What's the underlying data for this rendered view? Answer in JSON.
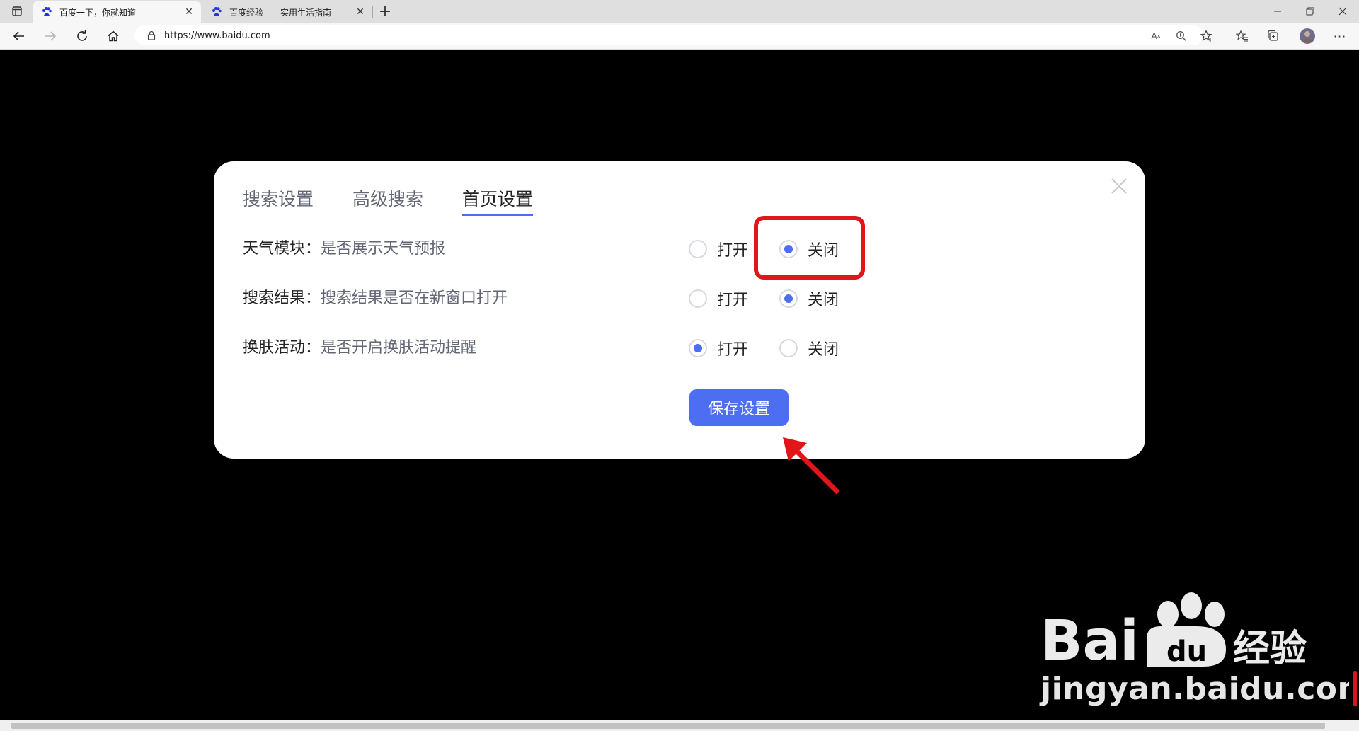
{
  "browser": {
    "tabs": [
      {
        "title": "百度一下，你就知道",
        "active": true,
        "favicon": "baidu-paw-icon"
      },
      {
        "title": "百度经验——实用生活指南",
        "active": false,
        "favicon": "baidu-paw-icon"
      }
    ],
    "url": "https://www.baidu.com",
    "new_tab_symbol": "+"
  },
  "modal": {
    "tabs": [
      {
        "label": "搜索设置",
        "active": false
      },
      {
        "label": "高级搜索",
        "active": false
      },
      {
        "label": "首页设置",
        "active": true
      }
    ],
    "settings": [
      {
        "name": "天气模块：",
        "desc": "是否展示天气预报",
        "open_label": "打开",
        "close_label": "关闭",
        "selected": "关闭"
      },
      {
        "name": "搜索结果：",
        "desc": "搜索结果是否在新窗口打开",
        "open_label": "打开",
        "close_label": "关闭",
        "selected": "关闭"
      },
      {
        "name": "换肤活动：",
        "desc": "是否开启换肤活动提醒",
        "open_label": "打开",
        "close_label": "关闭",
        "selected": "打开"
      }
    ],
    "save_label": "保存设置"
  },
  "annotation": {
    "highlight_color": "#e2151b",
    "arrow_color": "#e2151b"
  },
  "watermark": {
    "brand": "Bai du 经验",
    "url": "jingyan.baidu.com"
  },
  "colors": {
    "accent": "#4e6ef2",
    "page_background": "#000000"
  }
}
